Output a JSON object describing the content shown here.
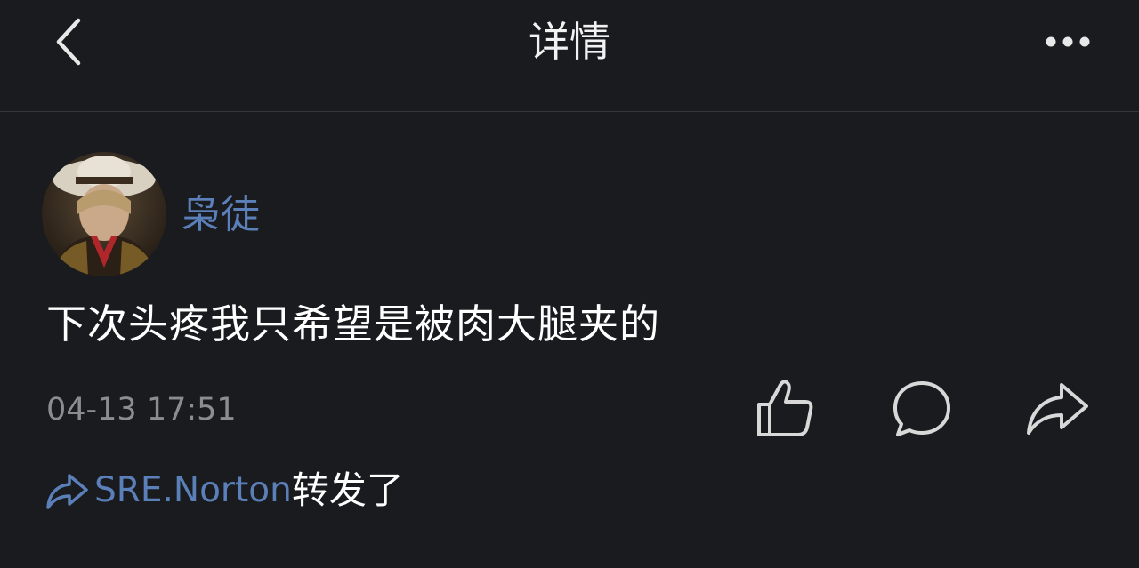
{
  "header": {
    "title": "详情",
    "back_icon": "chevron-left-icon",
    "more_icon": "more-horizontal-icon"
  },
  "post": {
    "author": "枭徒",
    "text": "下次头疼我只希望是被肉大腿夹的",
    "timestamp": "04-13 17:51",
    "actions": [
      "like-icon",
      "comment-icon",
      "share-icon"
    ]
  },
  "repost": {
    "icon": "share-icon",
    "user": "SRE.Norton",
    "suffix": "转发了"
  },
  "colors": {
    "background": "#1a1b1e",
    "link": "#5b7fb8",
    "muted": "#8c8d90",
    "icon": "#d8d8d8"
  }
}
